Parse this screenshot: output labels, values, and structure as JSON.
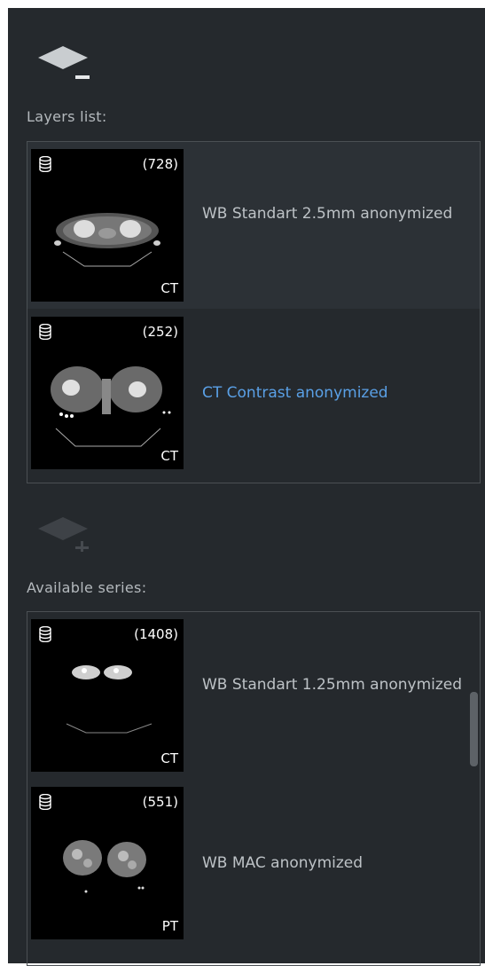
{
  "layers_section": {
    "label": "Layers list:",
    "items": [
      {
        "count": "(728)",
        "modality": "CT",
        "name": "WB Standart 2.5mm anonymized"
      },
      {
        "count": "(252)",
        "modality": "CT",
        "name": "CT Contrast anonymized"
      }
    ]
  },
  "available_section": {
    "label": "Available series:",
    "items": [
      {
        "count": "(1408)",
        "modality": "CT",
        "name": "WB Standart 1.25mm anonymized"
      },
      {
        "count": "(551)",
        "modality": "PT",
        "name": "WB MAC anonymized"
      }
    ]
  },
  "icons": {
    "remove_layer": "layer-remove-icon",
    "add_layer": "layer-add-icon",
    "series_stack": "database-stack-icon"
  },
  "colors": {
    "panel_bg": "#25292d",
    "selected_text": "#5aa0e6",
    "text": "#bdc2c6"
  }
}
